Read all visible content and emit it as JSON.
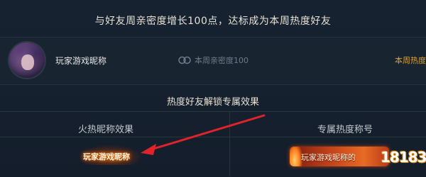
{
  "header": {
    "text": "与好友周亲密度增长100点，达标成为本周热度好友"
  },
  "friend": {
    "name": "玩家游戏昵称",
    "intimacy": "本周亲密度100",
    "hot_label": "本周热度"
  },
  "section": {
    "title": "热度好友解锁专属效果"
  },
  "columns": {
    "left_header": "火热昵称效果",
    "right_header": "专属热度称号"
  },
  "effects": {
    "fire_name": "玩家游戏昵称",
    "badge_name": "玩家游戏昵称的"
  },
  "watermark": {
    "text": "18183"
  },
  "colors": {
    "accent": "#d8a23c",
    "arrow": "#e0232b",
    "fire": "#ff7a00"
  }
}
